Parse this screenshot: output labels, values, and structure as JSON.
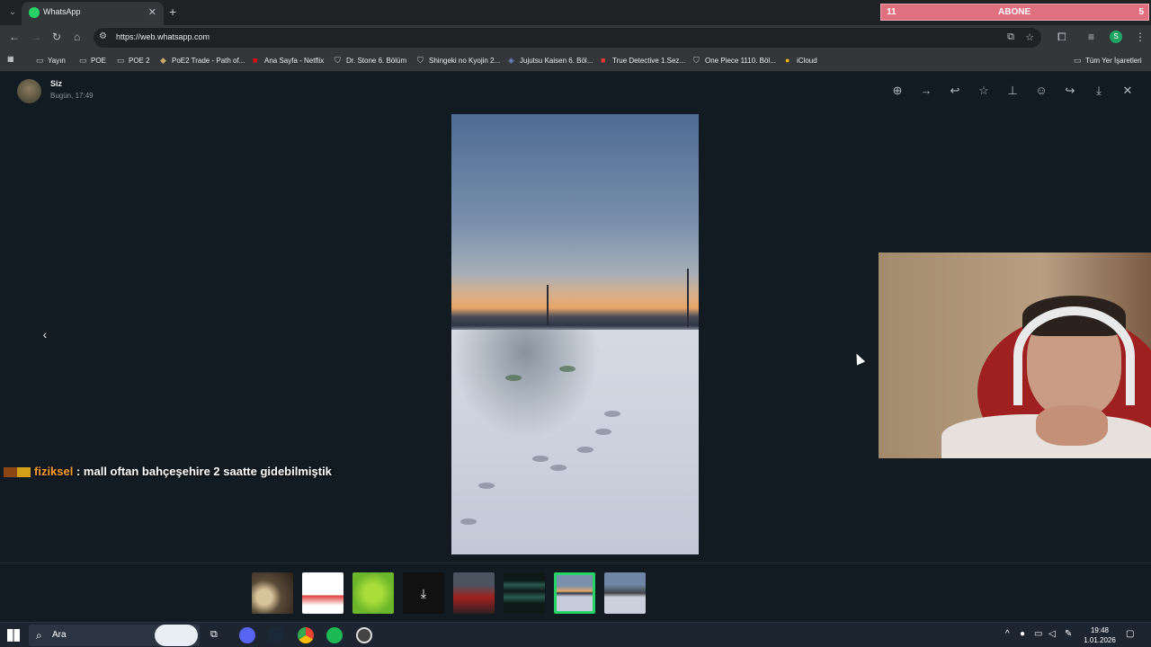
{
  "browser": {
    "tab_title": "WhatsApp",
    "url": "https://web.whatsapp.com",
    "profile_initial": "S",
    "bookmarks": [
      {
        "label": "Yayın"
      },
      {
        "label": "POE"
      },
      {
        "label": "POE 2"
      },
      {
        "label": "PoE2 Trade - Path of..."
      },
      {
        "label": "Ana Sayfa - Netflix"
      },
      {
        "label": "Dr. Stone 6. Bölüm"
      },
      {
        "label": "Shingeki no Kyojin 2..."
      },
      {
        "label": "Jujutsu Kaisen 6. Böl..."
      },
      {
        "label": "True Detective 1.Sez..."
      },
      {
        "label": "One Piece 1110. Böl..."
      },
      {
        "label": "iCloud"
      }
    ],
    "all_bookmarks": "Tüm Yer İşaretleri"
  },
  "overlay": {
    "left_count": "11",
    "label": "ABONE",
    "right_count": "5"
  },
  "viewer": {
    "sender": "Siz",
    "time": "Bugün, 17:49"
  },
  "chat": {
    "username": "fiziksel",
    "message": ": mall oftan bahçeşehire 2 saatte gidebilmiştik"
  },
  "taskbar": {
    "search_placeholder": "Ara",
    "time": "19:48",
    "date": "1.01.2026"
  }
}
